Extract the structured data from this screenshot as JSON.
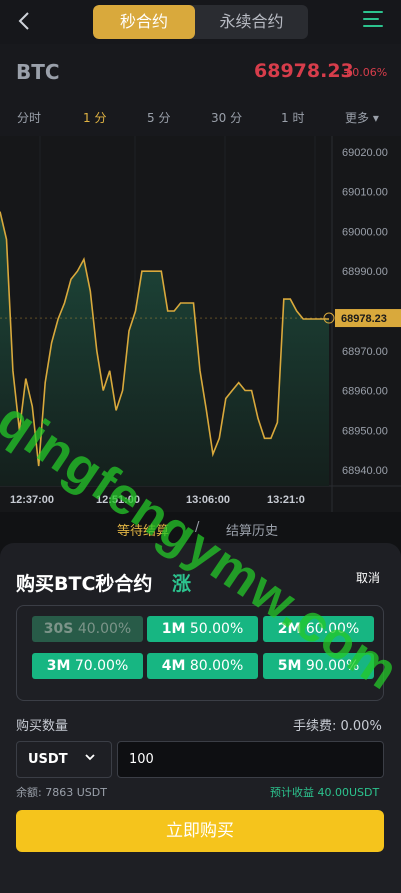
{
  "header": {
    "tabs": [
      {
        "label": "秒合约",
        "active": true
      },
      {
        "label": "永续合约",
        "active": false
      }
    ]
  },
  "ticker": {
    "symbol": "BTC",
    "price": "68978.23",
    "change": "+0.06%"
  },
  "timeframes": [
    {
      "label": "分时",
      "active": false
    },
    {
      "label": "1 分",
      "active": true
    },
    {
      "label": "5 分",
      "active": false
    },
    {
      "label": "30 分",
      "active": false
    },
    {
      "label": "1 时",
      "active": false
    },
    {
      "label": "更多 ▾",
      "active": false
    }
  ],
  "chart_data": {
    "type": "area",
    "y_ticks": [
      "69020.00",
      "69010.00",
      "69000.00",
      "68990.00",
      "68970.00",
      "68960.00",
      "68950.00",
      "68940.00"
    ],
    "x_ticks": [
      "12:37:00",
      "12:51:00",
      "13:06:00",
      "13:21:0"
    ],
    "ylim": [
      68936,
      69024
    ],
    "current_price_label": "68978.23",
    "values": [
      69005,
      68998,
      68965,
      68950,
      68963,
      68956,
      68941,
      68962,
      68972,
      68978,
      68982,
      68988,
      68990,
      68993,
      68985,
      68970,
      68960,
      68965,
      68955,
      68960,
      68975,
      68980,
      68990,
      68990,
      68990,
      68990,
      68980,
      68980,
      68982,
      68982,
      68982,
      68965,
      68955,
      68944,
      68948,
      68958,
      68960,
      68962,
      68960,
      68960,
      68953,
      68948,
      68948,
      68952,
      68983,
      68983,
      68980,
      68978,
      68978,
      68978,
      68978,
      68978
    ],
    "colors": {
      "line": "#d9a93c",
      "fill_top": "#1e4a3c",
      "fill_bottom": "#141f1c"
    }
  },
  "record_tabs": {
    "pending": "等待结算",
    "sep": "/",
    "history": "结算历史"
  },
  "sheet": {
    "title": "购买BTC秒合约",
    "direction": "涨",
    "cancel": "取消",
    "options": [
      {
        "duration": "30S",
        "rate": "40.00%",
        "disabled": true
      },
      {
        "duration": "1M",
        "rate": "50.00%",
        "disabled": false
      },
      {
        "duration": "2M",
        "rate": "60.00%",
        "disabled": false
      },
      {
        "duration": "3M",
        "rate": "70.00%",
        "disabled": false
      },
      {
        "duration": "4M",
        "rate": "80.00%",
        "disabled": false
      },
      {
        "duration": "5M",
        "rate": "90.00%",
        "disabled": false
      }
    ],
    "qty_label": "购买数量",
    "fee_label": "手续费: 0.00%",
    "currency": "USDT",
    "amount": "100",
    "balance": "余额: 7863 USDT",
    "expected": "预计收益 40.00USDT",
    "buy_label": "立即购买"
  },
  "watermark": "qingfengymw.com",
  "colors": {
    "accent_gold": "#d9a93c",
    "up_green": "#2cc38e",
    "down_red": "#d73d4b",
    "buy_yellow": "#f5c41c"
  }
}
